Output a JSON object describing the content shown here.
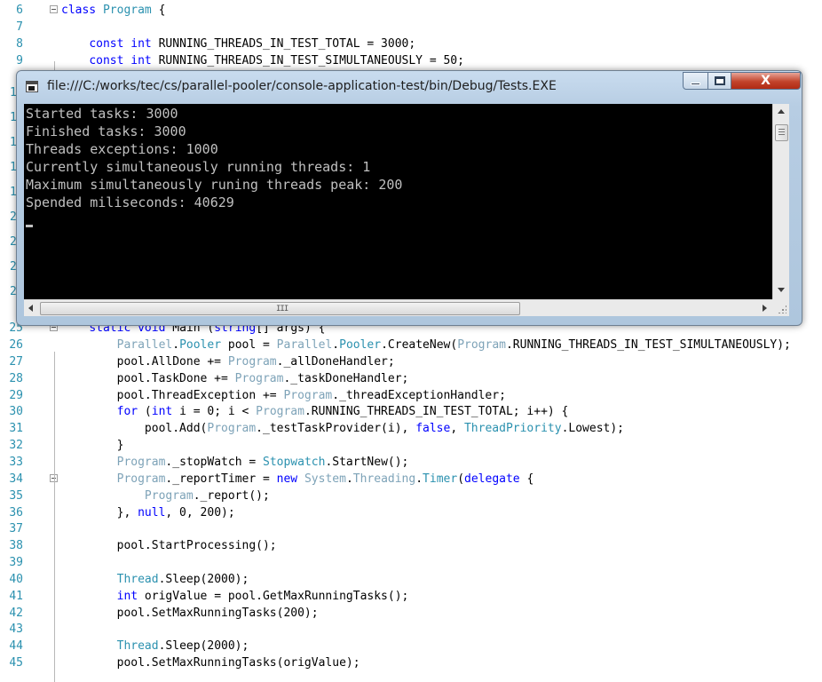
{
  "window": {
    "title": "file:///C:/works/tec/cs/parallel-pooler/console-application-test/bin/Debug/Tests.EXE",
    "close_label": "X",
    "console_lines": [
      "Started tasks: 3000",
      "Finished tasks: 3000",
      "Threads exceptions: 1000",
      "Currently simultaneously running threads: 1",
      "Maximum simultaneously runing threads peak: 200",
      "Spended miliseconds: 40629"
    ],
    "hscroll_grip": "III"
  },
  "editor": {
    "lines": [
      {
        "n": "6",
        "segs": [
          [
            "kw",
            "class"
          ],
          [
            "",
            " "
          ],
          [
            "ty",
            "Program"
          ],
          [
            "",
            " {"
          ]
        ]
      },
      {
        "n": "7",
        "segs": []
      },
      {
        "n": "8",
        "segs": [
          [
            "",
            "    "
          ],
          [
            "kw",
            "const"
          ],
          [
            "",
            " "
          ],
          [
            "kw",
            "int"
          ],
          [
            "",
            " RUNNING_THREADS_IN_TEST_TOTAL = 3000;"
          ]
        ]
      },
      {
        "n": "9",
        "segs": [
          [
            "",
            "    "
          ],
          [
            "kw",
            "const"
          ],
          [
            "",
            " "
          ],
          [
            "kw",
            "int"
          ],
          [
            "",
            " RUNNING_THREADS_IN_TEST_SIMULTANEOUSLY = 50;"
          ]
        ]
      },
      {
        "n": "25",
        "segs": [
          [
            "",
            "    "
          ],
          [
            "kw",
            "static"
          ],
          [
            "",
            " "
          ],
          [
            "kw",
            "void"
          ],
          [
            "",
            " Main ("
          ],
          [
            "kw",
            "string"
          ],
          [
            "",
            "[] args) {"
          ]
        ]
      },
      {
        "n": "26",
        "segs": [
          [
            "",
            "        "
          ],
          [
            "ns",
            "Parallel"
          ],
          [
            "",
            "."
          ],
          [
            "ty",
            "Pooler"
          ],
          [
            "",
            " pool = "
          ],
          [
            "ns",
            "Parallel"
          ],
          [
            "",
            "."
          ],
          [
            "ty",
            "Pooler"
          ],
          [
            "",
            ".CreateNew("
          ],
          [
            "ns",
            "Program"
          ],
          [
            "",
            ".RUNNING_THREADS_IN_TEST_SIMULTANEOUSLY);"
          ]
        ]
      },
      {
        "n": "27",
        "segs": [
          [
            "",
            "        pool.AllDone += "
          ],
          [
            "ns",
            "Program"
          ],
          [
            "",
            "._allDoneHandler;"
          ]
        ]
      },
      {
        "n": "28",
        "segs": [
          [
            "",
            "        pool.TaskDone += "
          ],
          [
            "ns",
            "Program"
          ],
          [
            "",
            "._taskDoneHandler;"
          ]
        ]
      },
      {
        "n": "29",
        "segs": [
          [
            "",
            "        pool.ThreadException += "
          ],
          [
            "ns",
            "Program"
          ],
          [
            "",
            "._threadExceptionHandler;"
          ]
        ]
      },
      {
        "n": "30",
        "segs": [
          [
            "",
            "        "
          ],
          [
            "kw",
            "for"
          ],
          [
            "",
            " ("
          ],
          [
            "kw",
            "int"
          ],
          [
            "",
            " i = 0; i < "
          ],
          [
            "ns",
            "Program"
          ],
          [
            "",
            ".RUNNING_THREADS_IN_TEST_TOTAL; i++) {"
          ]
        ]
      },
      {
        "n": "31",
        "segs": [
          [
            "",
            "            pool.Add("
          ],
          [
            "ns",
            "Program"
          ],
          [
            "",
            "._testTaskProvider(i), "
          ],
          [
            "kw",
            "false"
          ],
          [
            "",
            ", "
          ],
          [
            "ty",
            "ThreadPriority"
          ],
          [
            "",
            ".Lowest);"
          ]
        ]
      },
      {
        "n": "32",
        "segs": [
          [
            "",
            "        }"
          ]
        ]
      },
      {
        "n": "33",
        "segs": [
          [
            "",
            "        "
          ],
          [
            "ns",
            "Program"
          ],
          [
            "",
            "._stopWatch = "
          ],
          [
            "ty",
            "Stopwatch"
          ],
          [
            "",
            ".StartNew();"
          ]
        ]
      },
      {
        "n": "34",
        "segs": [
          [
            "",
            "        "
          ],
          [
            "ns",
            "Program"
          ],
          [
            "",
            "._reportTimer = "
          ],
          [
            "kw",
            "new"
          ],
          [
            "",
            " "
          ],
          [
            "ns",
            "System"
          ],
          [
            "",
            "."
          ],
          [
            "ns",
            "Threading"
          ],
          [
            "",
            "."
          ],
          [
            "ty",
            "Timer"
          ],
          [
            "",
            "("
          ],
          [
            "kw",
            "delegate"
          ],
          [
            "",
            " {"
          ]
        ]
      },
      {
        "n": "35",
        "segs": [
          [
            "",
            "            "
          ],
          [
            "ns",
            "Program"
          ],
          [
            "",
            "._report();"
          ]
        ]
      },
      {
        "n": "36",
        "segs": [
          [
            "",
            "        }, "
          ],
          [
            "kw",
            "null"
          ],
          [
            "",
            ", 0, 200);"
          ]
        ]
      },
      {
        "n": "37",
        "segs": []
      },
      {
        "n": "38",
        "segs": [
          [
            "",
            "        pool.StartProcessing();"
          ]
        ]
      },
      {
        "n": "39",
        "segs": []
      },
      {
        "n": "40",
        "segs": [
          [
            "",
            "        "
          ],
          [
            "ty",
            "Thread"
          ],
          [
            "",
            ".Sleep(2000);"
          ]
        ]
      },
      {
        "n": "41",
        "segs": [
          [
            "",
            "        "
          ],
          [
            "kw",
            "int"
          ],
          [
            "",
            " origValue = pool.GetMaxRunningTasks();"
          ]
        ]
      },
      {
        "n": "42",
        "segs": [
          [
            "",
            "        pool.SetMaxRunningTasks(200);"
          ]
        ]
      },
      {
        "n": "43",
        "segs": []
      },
      {
        "n": "44",
        "segs": [
          [
            "",
            "        "
          ],
          [
            "ty",
            "Thread"
          ],
          [
            "",
            ".Sleep(2000);"
          ]
        ]
      },
      {
        "n": "45",
        "segs": [
          [
            "",
            "        pool.SetMaxRunningTasks(origValue);"
          ]
        ]
      }
    ],
    "hidden_line_numbers": [
      "1",
      "1",
      "1",
      "1",
      "1",
      "2",
      "2",
      "2",
      "2"
    ]
  }
}
